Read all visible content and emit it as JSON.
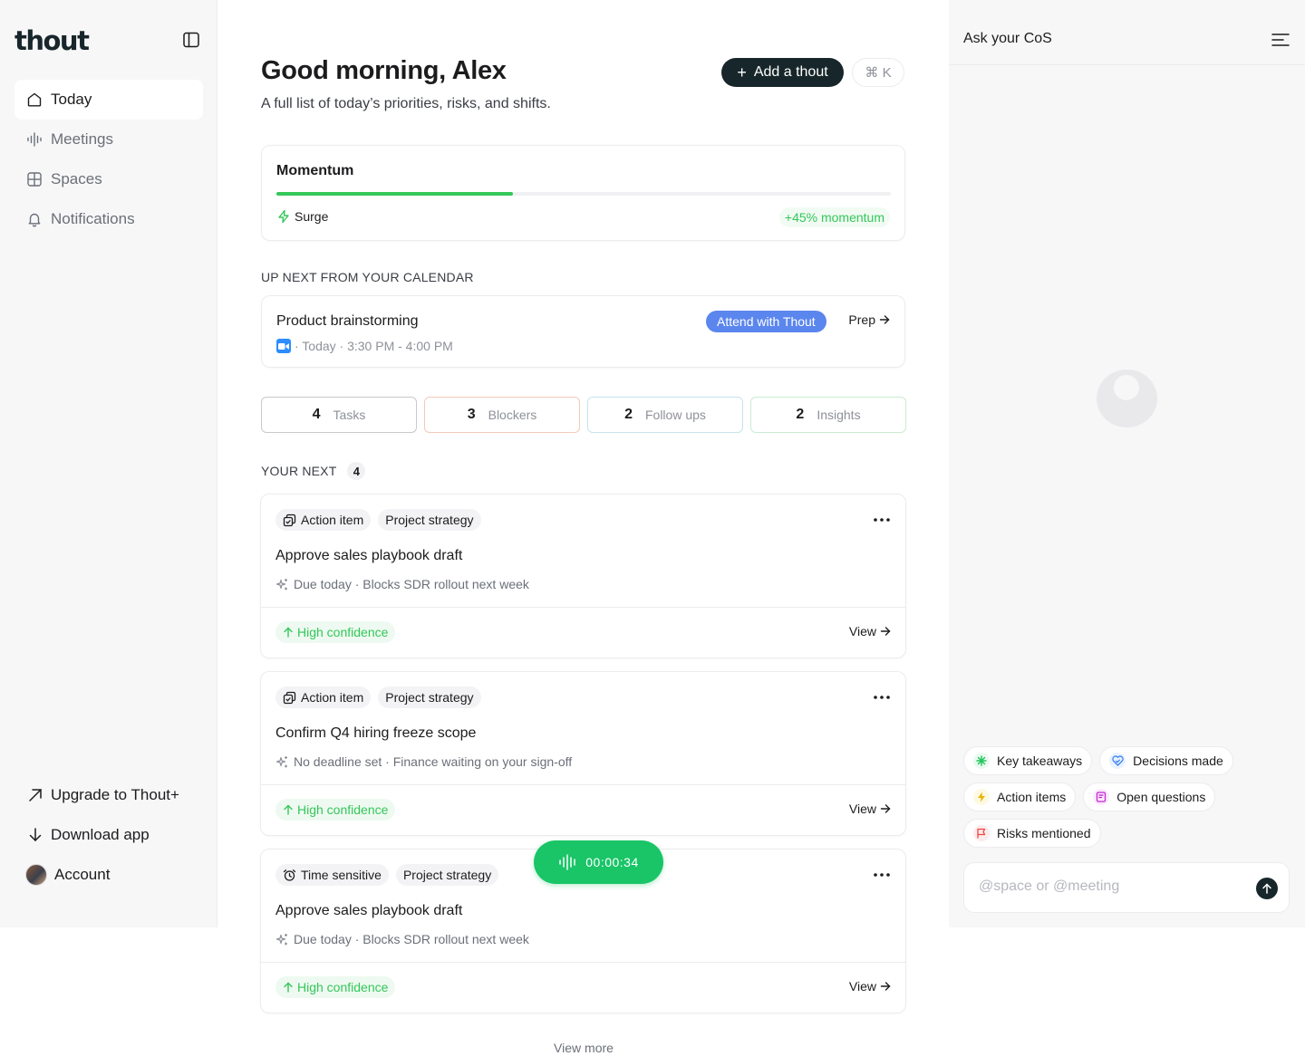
{
  "sidebar": {
    "logo": "thout",
    "items": [
      {
        "label": "Today",
        "icon": "home-icon"
      },
      {
        "label": "Meetings",
        "icon": "waveform-icon"
      },
      {
        "label": "Spaces",
        "icon": "grid-icon"
      },
      {
        "label": "Notifications",
        "icon": "bell-icon"
      }
    ],
    "bottom": {
      "upgrade": "Upgrade to Thout+",
      "download": "Download app",
      "account": "Account"
    }
  },
  "header": {
    "greeting": "Good morning, Alex",
    "subtitle": "A full list of today’s priorities, risks, and shifts.",
    "add_label": "Add a thout",
    "shortcut": "⌘ K"
  },
  "momentum": {
    "title": "Momentum",
    "progress": 0.385,
    "status": "Surge",
    "badge": "+45% momentum"
  },
  "calendar": {
    "section_label": "UP NEXT FROM YOUR CALENDAR",
    "event_title": "Product brainstorming",
    "event_meta": "· Today · 3:30 PM - 4:00 PM",
    "attend_label": "Attend with Thout",
    "prep_label": "Prep"
  },
  "stats": [
    {
      "num": "4",
      "label": "Tasks",
      "border": "#c9c9ce"
    },
    {
      "num": "3",
      "label": "Blockers",
      "border": "#f3c9b8"
    },
    {
      "num": "2",
      "label": "Follow ups",
      "border": "#c6e4ec"
    },
    {
      "num": "2",
      "label": "Insights",
      "border": "#c9ecd2"
    }
  ],
  "your_next": {
    "label": "YOUR NEXT",
    "count": "4",
    "tasks": [
      {
        "type": "Action item",
        "type_icon": "action-item-icon",
        "space": "Project strategy",
        "title": "Approve sales playbook draft",
        "meta": "Due today · Blocks SDR rollout next week",
        "confidence": "High confidence",
        "view": "View"
      },
      {
        "type": "Action item",
        "type_icon": "action-item-icon",
        "space": "Project strategy",
        "title": "Confirm Q4 hiring freeze scope",
        "meta": "No deadline set · Finance waiting on your sign-off",
        "confidence": "High confidence",
        "view": "View"
      },
      {
        "type": "Time sensitive",
        "type_icon": "alarm-icon",
        "space": "Project strategy",
        "title": "Approve sales playbook draft",
        "meta": "Due today · Blocks SDR rollout next week",
        "confidence": "High confidence",
        "view": "View"
      }
    ],
    "view_more": "View more"
  },
  "recorder": {
    "time": "00:00:34"
  },
  "panel": {
    "title": "Ask your CoS",
    "chips": [
      {
        "label": "Key takeaways",
        "icon": "sparkle-icon",
        "color": "#22c55e",
        "bg": "#eafaf0"
      },
      {
        "label": "Decisions made",
        "icon": "heart-check-icon",
        "color": "#3b82f6",
        "bg": "#e9f2ff"
      },
      {
        "label": "Action items",
        "icon": "lightning-icon",
        "color": "#eab308",
        "bg": "#fef9e3"
      },
      {
        "label": "Open questions",
        "icon": "question-doc-icon",
        "color": "#c026d3",
        "bg": "#fbeafd"
      },
      {
        "label": "Risks mentioned",
        "icon": "flag-icon",
        "color": "#ef4444",
        "bg": "#fdecec"
      }
    ],
    "input_placeholder": "@space or @meeting"
  }
}
